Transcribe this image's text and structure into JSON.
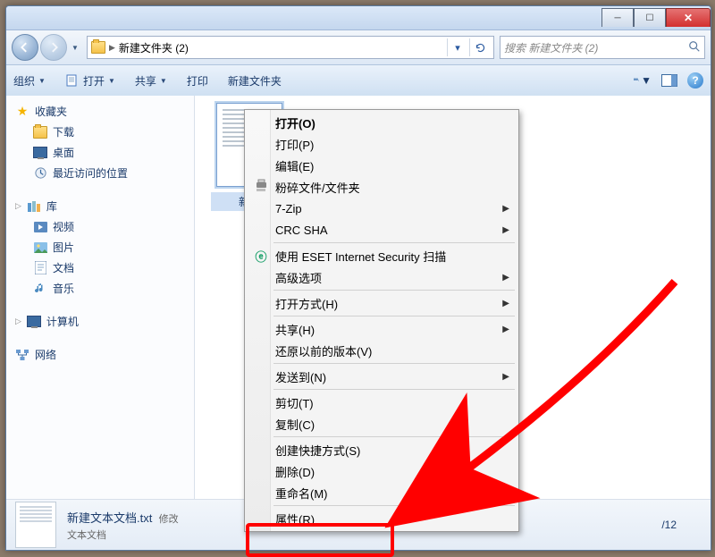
{
  "titlebar": {},
  "navbar": {
    "breadcrumb_root": "",
    "breadcrumb_current": "新建文件夹 (2)",
    "search_placeholder": "搜索 新建文件夹 (2)"
  },
  "toolbar": {
    "organize": "组织",
    "open": "打开",
    "share": "共享",
    "print": "打印",
    "new_folder": "新建文件夹"
  },
  "sidebar": {
    "favorites": {
      "label": "收藏夹",
      "items": [
        "下载",
        "桌面",
        "最近访问的位置"
      ]
    },
    "libraries": {
      "label": "库",
      "items": [
        "视频",
        "图片",
        "文档",
        "音乐"
      ]
    },
    "computer": {
      "label": "计算机"
    },
    "network": {
      "label": "网络"
    }
  },
  "content": {
    "selected_file_truncated": "新建"
  },
  "context_menu": {
    "open": "打开(O)",
    "print": "打印(P)",
    "edit": "编辑(E)",
    "shred": "粉碎文件/文件夹",
    "seven_zip": "7-Zip",
    "crc_sha": "CRC SHA",
    "eset_scan": "使用 ESET Internet Security 扫描",
    "advanced": "高级选项",
    "open_with": "打开方式(H)",
    "share": "共享(H)",
    "restore_prev": "还原以前的版本(V)",
    "send_to": "发送到(N)",
    "cut": "剪切(T)",
    "copy": "复制(C)",
    "create_shortcut": "创建快捷方式(S)",
    "delete": "删除(D)",
    "rename": "重命名(M)",
    "properties": "属性(R)"
  },
  "statusbar": {
    "filename": "新建文本文档.txt",
    "modified_label": "修改",
    "filetype": "文本文档",
    "date_fragment": "/12"
  },
  "annotation": {
    "highlight_target": "properties"
  }
}
